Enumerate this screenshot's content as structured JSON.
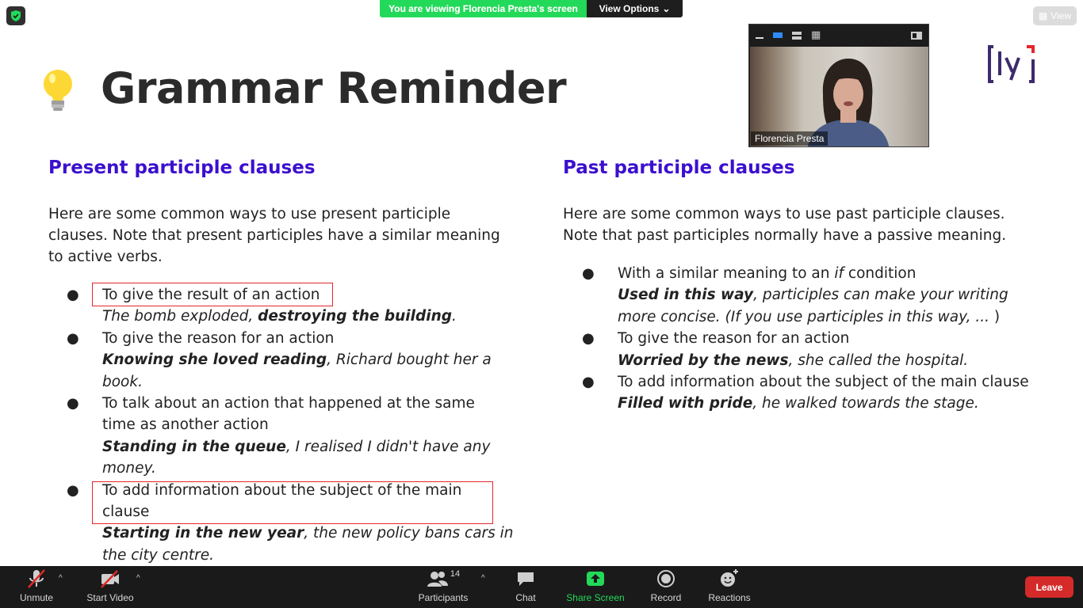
{
  "banner": {
    "message": "You are viewing Florencia Presta's screen",
    "options_label": "View Options",
    "view_label": "View"
  },
  "slide": {
    "title": "Grammar Reminder",
    "left": {
      "heading": "Present participle clauses",
      "intro_lines": [
        "Here are some common ways to use present participle",
        "clauses. Note that present participles have a similar meaning",
        "to active verbs."
      ],
      "items": [
        {
          "lines": [
            "To give the result of an action"
          ],
          "example_lines": [
            [
              "The bomb exploded, ",
              "destroying the building",
              "."
            ]
          ]
        },
        {
          "lines": [
            "To give the reason for an action"
          ],
          "example_lines": [
            [
              "",
              "Knowing she loved reading",
              ", Richard bought her a"
            ],
            [
              "book.",
              "",
              ""
            ]
          ]
        },
        {
          "lines": [
            "To talk about an action that happened at the same",
            "time as another action"
          ],
          "example_lines": [
            [
              "",
              "Standing in the queue",
              ", I realised I didn't have any"
            ],
            [
              "money.",
              "",
              ""
            ]
          ]
        },
        {
          "lines": [
            "To add information about the subject of the main",
            "clause"
          ],
          "example_lines": [
            [
              "",
              "Starting in the new year",
              ", the new policy bans cars in"
            ],
            [
              "the city centre.",
              "",
              ""
            ]
          ]
        }
      ]
    },
    "right": {
      "heading": "Past participle clauses",
      "intro_lines": [
        "Here are some common ways to use past participle clauses.",
        "Note that past participles normally have a passive meaning."
      ],
      "items": [
        {
          "line_pre": "With a similar meaning to an ",
          "line_em": "if",
          "line_post": " condition",
          "ex1_bold": "Used in this way",
          "ex1_rest": ", participles can make your writing",
          "ex2": "more concise. (",
          "ex2_em": "If you use participles in this way, ...",
          "ex2_end": " )"
        },
        {
          "line": "To give the reason for an action",
          "ex_bold": "Worried by the news",
          "ex_rest": ", she called the hospital."
        },
        {
          "line": "To add information about the subject of the main clause",
          "ex_bold": "Filled with pride",
          "ex_rest": ", he walked towards the stage."
        }
      ]
    }
  },
  "video": {
    "participant_name": "Florencia Presta"
  },
  "toolbar": {
    "unmute": "Unmute",
    "start_video": "Start Video",
    "participants": "Participants",
    "participant_count": "14",
    "chat": "Chat",
    "share_screen": "Share Screen",
    "record": "Record",
    "reactions": "Reactions",
    "leave": "Leave"
  },
  "colors": {
    "heading": "#3b0fcf",
    "share_green": "#23d959",
    "leave_red": "#d42a2a",
    "highlight_box": "#e3262c"
  }
}
